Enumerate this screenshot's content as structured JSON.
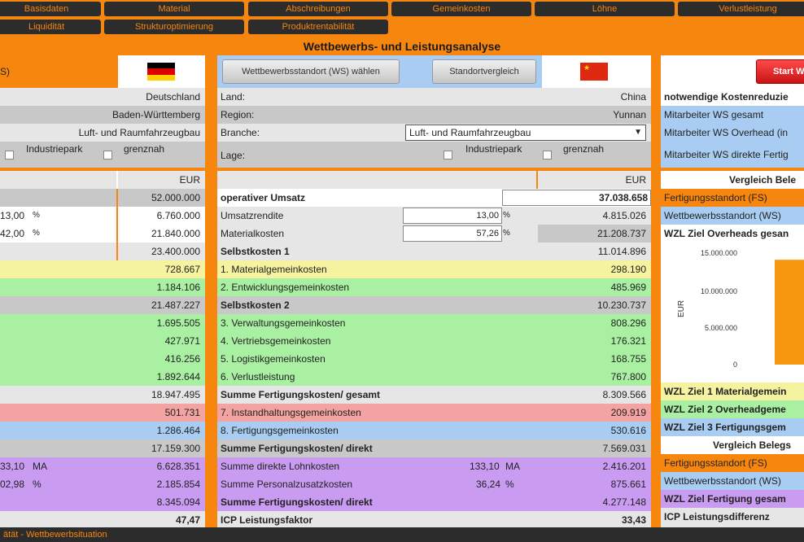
{
  "tabs_row1": [
    "Basisdaten",
    "Material",
    "Abschreibungen",
    "Gemeinkosten",
    "Löhne",
    "Verlustleistung"
  ],
  "tabs_row2": [
    "Liquidität",
    "Strukturoptimierung",
    "Produktrentabilität"
  ],
  "page_title": "Wettbewerbs- und Leistungsanalyse",
  "left": {
    "header_fragment": "S)",
    "land": "Deutschland",
    "region": "Baden-Württemberg",
    "branche": "Luft- und Raumfahrzeugbau",
    "industriepark": "Industriepark",
    "grenznah": "grenznah",
    "currency": "EUR",
    "umsatz": "52.000.000",
    "umsatzrendite_pct": "13,00",
    "umsatzrendite_sym": "%",
    "umsatzrendite": "6.760.000",
    "material_pct": "42,00",
    "material_sym": "%",
    "material": "21.840.000",
    "sk1": "23.400.000",
    "mgk": "728.667",
    "egk": "1.184.106",
    "sk2": "21.487.227",
    "vwgk": "1.695.505",
    "vtgk": "427.971",
    "lgk": "416.256",
    "vl": "1.892.644",
    "sfk": "18.947.495",
    "ihgk": "501.731",
    "fgk": "1.286.464",
    "sfk_direkt": "17.159.300",
    "lohn_ma": "33,10",
    "lohn_unit": "MA",
    "lohn": "6.628.351",
    "pz_pct": "02,98",
    "pz_unit": "%",
    "pz": "2.185.854",
    "sfk_direkt2": "8.345.094",
    "icp": "47,47"
  },
  "middle": {
    "ws_button": "Wettbewerbsstandort (WS) wählen",
    "sv_button": "Standortvergleich",
    "land_label": "Land:",
    "land": "China",
    "region_label": "Region:",
    "region": "Yunnan",
    "branche_label": "Branche:",
    "branche": "Luft- und Raumfahrzeugbau",
    "lage_label": "Lage:",
    "industriepark": "Industriepark",
    "grenznah": "grenznah",
    "currency": "EUR",
    "rows": {
      "umsatz_label": "operativer Umsatz",
      "umsatz": "37.038.658",
      "ur_label": "Umsatzrendite",
      "ur_pct": "13,00",
      "ur_sym": "%",
      "ur": "4.815.026",
      "mk_label": "Materialkosten",
      "mk_pct": "57,26",
      "mk_sym": "%",
      "mk": "21.208.737",
      "sk1_label": "Selbstkosten 1",
      "sk1": "11.014.896",
      "mgk_label": "1. Materialgemeinkosten",
      "mgk": "298.190",
      "egk_label": "2. Entwicklungsgemeinkosten",
      "egk": "485.969",
      "sk2_label": "Selbstkosten 2",
      "sk2": "10.230.737",
      "vwgk_label": "3. Verwaltungsgemeinkosten",
      "vwgk": "808.296",
      "vtgk_label": "4. Vertriebsgemeinkosten",
      "vtgk": "176.321",
      "lgk_label": "5. Logistikgemeinkosten",
      "lgk": "168.755",
      "vl_label": "6. Verlustleistung",
      "vl": "767.800",
      "sfk_label": "Summe Fertigungskosten/ gesamt",
      "sfk": "8.309.566",
      "ihgk_label": "7. Instandhaltungsgemeinkosten",
      "ihgk": "209.919",
      "fgk_label": "8. Fertigungsgemeinkosten",
      "fgk": "530.616",
      "sfkd_label": "Summe Fertigungskosten/ direkt",
      "sfkd": "7.569.031",
      "lohn_label": "Summe direkte Lohnkosten",
      "lohn_ma": "133,10",
      "lohn_unit": "MA",
      "lohn": "2.416.201",
      "pz_label": "Summe Personalzusatzkosten",
      "pz_pct": "36,24",
      "pz_unit": "%",
      "pz": "875.661",
      "sfkd2_label": "Summe Fertigungskosten/ direkt",
      "sfkd2": "4.277.148",
      "icp_label": "ICP Leistungsfaktor",
      "icp": "33,43"
    }
  },
  "right": {
    "start_button": "Start W",
    "kr_title": "notwendige Kostenreduzie",
    "ma_ws": "Mitarbeiter WS gesamt",
    "ma_overhead": "Mitarbeiter WS Overhead (in",
    "ma_direkt": "Mitarbeiter WS direkte Fertig",
    "vergleich1": "Vergleich Bele",
    "fs": "Fertigungsstandort (FS)",
    "ws": "Wettbewerbsstandort (WS)",
    "wzl_overheads": "WZL Ziel Overheads gesan",
    "wzl1": "WZL Ziel 1 Materialgemein",
    "wzl2": "WZL Ziel 2 Overheadgeme",
    "wzl3": "WZL Ziel 3 Fertigungsgem",
    "vergleich2": "Vergleich Belegs",
    "fs2": "Fertigungsstandort (FS)",
    "ws2": "Wettbewerbsstandort (WS)",
    "wzl_fertigung": "WZL Ziel Fertigung gesam",
    "icp_diff": "ICP Leistungsdifferenz"
  },
  "chart_data": {
    "type": "bar",
    "ylabel": "EUR",
    "yticks": [
      "15.000.000",
      "10.000.000",
      "5.000.000",
      "0"
    ],
    "ylim": [
      0,
      15000000
    ],
    "values": [
      14000000
    ]
  },
  "status_text": "ätät - Wettbewerbsituation"
}
